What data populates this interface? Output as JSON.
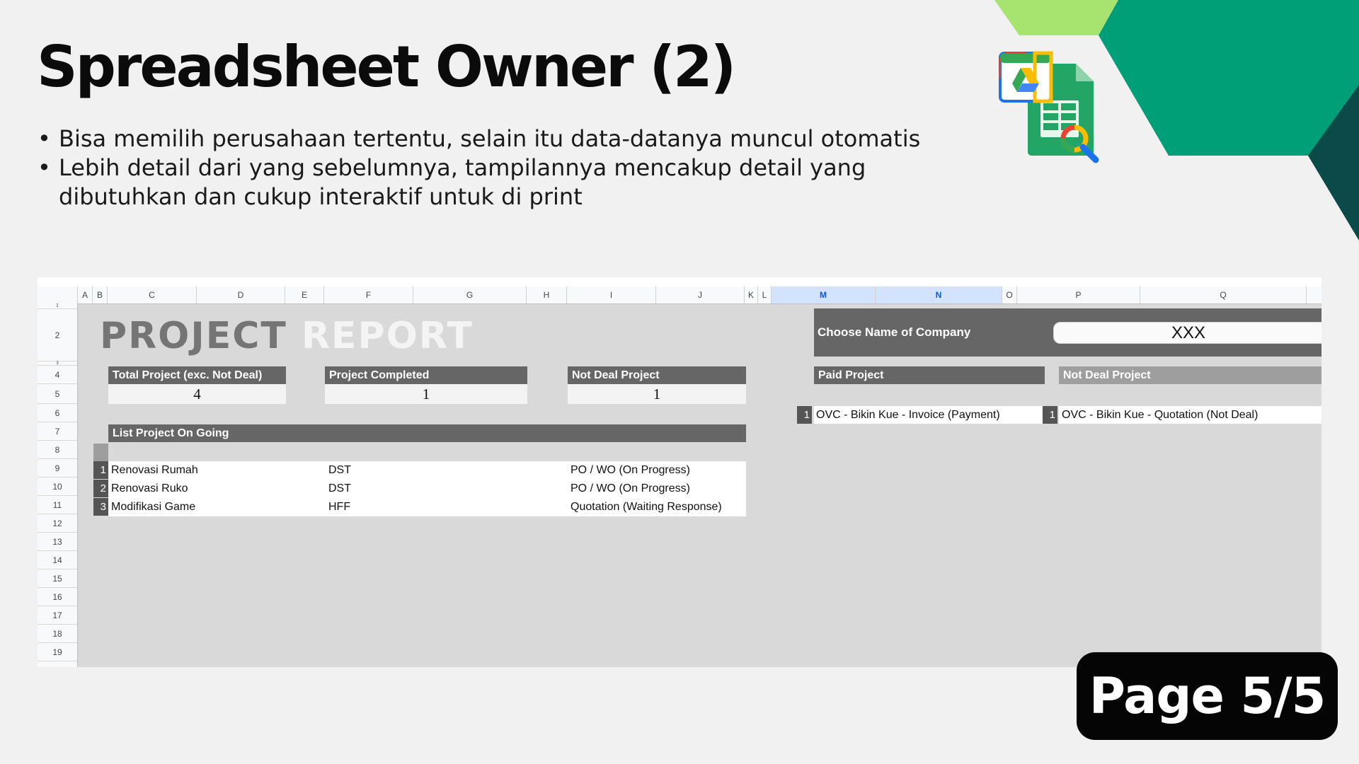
{
  "slide": {
    "title": "Spreadsheet Owner (2)",
    "bullets": [
      "Bisa memilih perusahaan tertentu, selain itu data-datanya muncul otomatis",
      "Lebih detail dari yang sebelumnya, tampilannya mencakup detail yang dibutuhkan dan cukup interaktif untuk di print"
    ],
    "page_label": "Page 5/5",
    "logo_icon": "google-sheets-drive-search-icon",
    "accent_colors": {
      "lime": "#a6e36f",
      "teal": "#009f77",
      "dark_teal": "#0a4a48"
    }
  },
  "sheet": {
    "columns": [
      "A",
      "B",
      "C",
      "D",
      "E",
      "F",
      "G",
      "H",
      "I",
      "J",
      "K",
      "L",
      "M",
      "N",
      "O",
      "P",
      "Q"
    ],
    "selected_columns": [
      "M",
      "N"
    ],
    "rows": [
      "1",
      "2",
      "3",
      "4",
      "5",
      "6",
      "7",
      "8",
      "9",
      "10",
      "11",
      "12",
      "13",
      "14",
      "15",
      "16",
      "17",
      "18",
      "19"
    ],
    "report_title_part1": "PROJECT",
    "report_title_part2": "REPORT",
    "stats": [
      {
        "label": "Total Project (exc. Not Deal)",
        "value": "4"
      },
      {
        "label": "Project Completed",
        "value": "1"
      },
      {
        "label": "Not Deal Project",
        "value": "1"
      }
    ],
    "company": {
      "label": "Choose Name of Company",
      "selected": "XXX"
    },
    "paid_project": {
      "label": "Paid Project",
      "items": [
        {
          "index": "1",
          "name": "OVC - Bikin Kue - Invoice (Payment)"
        }
      ]
    },
    "not_deal_project": {
      "label": "Not Deal Project",
      "items": [
        {
          "index": "1",
          "name": "OVC - Bikin Kue - Quotation (Not Deal)"
        }
      ]
    },
    "ongoing": {
      "label": "List Project On Going",
      "items": [
        {
          "index": "1",
          "name": "Renovasi Rumah",
          "code": "DST",
          "status": "PO / WO (On Progress)"
        },
        {
          "index": "2",
          "name": "Renovasi Ruko",
          "code": "DST",
          "status": "PO / WO (On Progress)"
        },
        {
          "index": "3",
          "name": "Modifikasi Game",
          "code": "HFF",
          "status": "Quotation (Waiting Response)"
        }
      ]
    }
  }
}
